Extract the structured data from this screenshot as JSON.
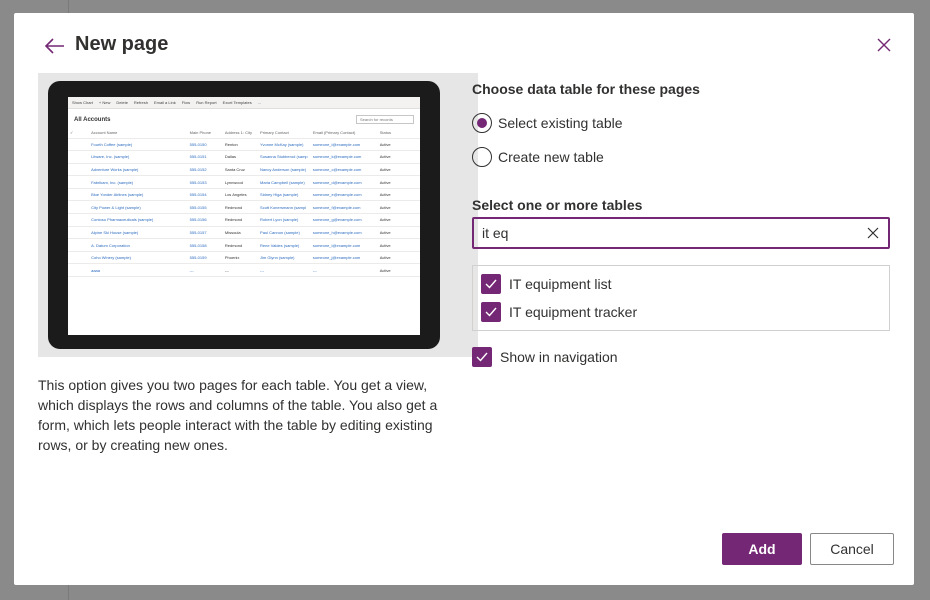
{
  "dialog": {
    "title": "New page"
  },
  "preview": {
    "toolbar": [
      "Show Chart",
      "+ New",
      "Delete",
      "Refresh",
      "Email a Link",
      "Flow",
      "Run Report",
      "Excel Templates",
      "..."
    ],
    "view_title": "All Accounts",
    "search_placeholder": "Search for records",
    "columns": [
      "Account Name",
      "Main Phone",
      "Address 1: City",
      "Primary Contact",
      "Email (Primary Contact)",
      "Status"
    ],
    "rows": [
      [
        "Fourth Coffee (sample)",
        "555-0150",
        "Renton",
        "Yvonne McKay (sample)",
        "someone_i@example.com",
        "Active"
      ],
      [
        "Litware, Inc. (sample)",
        "555-0151",
        "Dallas",
        "Susanna Stubberod (samp",
        "someone_k@example.com",
        "Active"
      ],
      [
        "Adventure Works (sample)",
        "555-0152",
        "Santa Cruz",
        "Nancy Anderson (sample)",
        "someone_c@example.com",
        "Active"
      ],
      [
        "Fabrikam, Inc. (sample)",
        "555-0153",
        "Lynnwood",
        "Maria Campbell (sample)",
        "someone_d@example.com",
        "Active"
      ],
      [
        "Blue Yonder Airlines (sample)",
        "555-0154",
        "Los Angeles",
        "Sidney Higa (sample)",
        "someone_e@example.com",
        "Active"
      ],
      [
        "City Power & Light (sample)",
        "555-0155",
        "Redmond",
        "Scott Konersmann (sampl",
        "someone_f@example.com",
        "Active"
      ],
      [
        "Contoso Pharmaceuticals (sample)",
        "555-0156",
        "Redmond",
        "Robert Lyon (sample)",
        "someone_g@example.com",
        "Active"
      ],
      [
        "Alpine Ski House (sample)",
        "555-0157",
        "Missoula",
        "Paul Cannon (sample)",
        "someone_h@example.com",
        "Active"
      ],
      [
        "A. Datum Corporation",
        "555-0158",
        "Redmond",
        "Rene Valdes (sample)",
        "someone_i@example.com",
        "Active"
      ],
      [
        "Coho Winery (sample)",
        "555-0159",
        "Phoenix",
        "Jim Glynn (sample)",
        "someone_j@example.com",
        "Active"
      ],
      [
        "aaaa",
        "---",
        "---",
        "---",
        "---",
        "Active"
      ]
    ]
  },
  "description": "This option gives you two pages for each table. You get a view, which displays the rows and columns of the table. You also get a form, which lets people interact with the table by editing existing rows, or by creating new ones.",
  "data_table": {
    "label": "Choose data table for these pages",
    "options": [
      {
        "label": "Select existing table",
        "selected": true
      },
      {
        "label": "Create new table",
        "selected": false
      }
    ]
  },
  "tables": {
    "label": "Select one or more tables",
    "search_value": "it eq",
    "results": [
      {
        "label": "IT equipment list",
        "checked": true
      },
      {
        "label": "IT equipment tracker",
        "checked": true
      }
    ]
  },
  "show_in_navigation": {
    "label": "Show in navigation",
    "checked": true
  },
  "buttons": {
    "add": "Add",
    "cancel": "Cancel"
  },
  "colors": {
    "accent": "#742774",
    "link": "#2b6bbf",
    "text": "#323130"
  }
}
